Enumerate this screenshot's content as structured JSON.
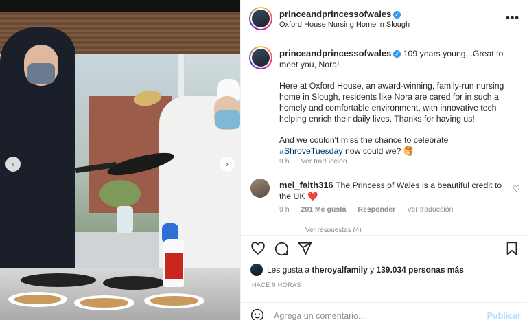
{
  "header": {
    "username": "princeandprincessofwales",
    "location": "Oxford House Nursing Home in Slough",
    "more_icon": "more-horizontal-icon"
  },
  "caption": {
    "username": "princeandprincessofwales",
    "p1": "109 years young...Great to meet you, Nora!",
    "p2": "Here at Oxford House, an award-winning, family-run nursing home in Slough, residents like Nora are cared for in such a homely and comfortable environment, with innovative tech helping enrich their daily lives. Thanks for having us!",
    "p3_prefix": "And we couldn't miss the chance to celebrate ",
    "p3_hashtag": "#ShroveTuesday",
    "p3_suffix": "now could we? 🥞",
    "time": "9 h",
    "translate": "Ver traducción"
  },
  "comment": {
    "username": "mel_faith316",
    "text": "The Princess of Wales is a beautiful credit to the UK",
    "emoji": "❤️",
    "time": "9 h",
    "likes": "201 Me gusta",
    "reply": "Responder",
    "translate": "Ver traducción",
    "view_replies": "Ver respuestas (4)"
  },
  "likes": {
    "prefix": "Les gusta a",
    "user": "theroyalfamily",
    "connector": "y",
    "count": "139.034 personas más"
  },
  "timestamp": "HACE 9 HORAS",
  "add_comment": {
    "placeholder": "Agrega un comentario...",
    "publish": "Publicar"
  },
  "colors": {
    "accent": "#3897f0",
    "hashtag": "#00376b",
    "muted": "#8e8e8e",
    "heart": "#ed4956"
  }
}
